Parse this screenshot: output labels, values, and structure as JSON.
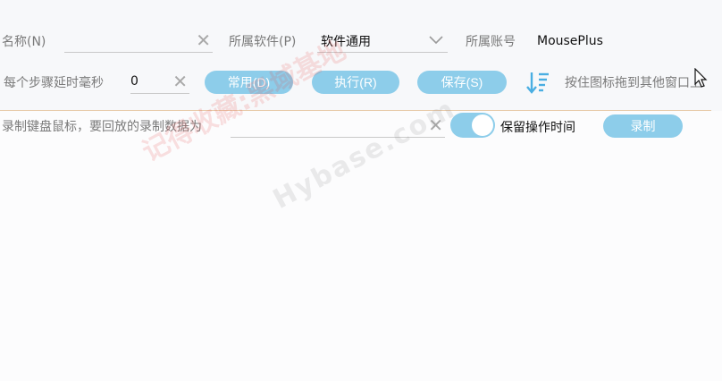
{
  "row1": {
    "name_label": "名称(N)",
    "name_value": "",
    "software_label": "所属软件(P)",
    "software_value": "软件通用",
    "account_label": "所属账号",
    "account_value": "MousePlus"
  },
  "row2": {
    "delay_label": "每个步骤延时毫秒",
    "delay_value": "0",
    "common_button": "常用(D)",
    "execute_button": "执行(R)",
    "save_button": "保存(S)",
    "drag_hint": "按住图标拖到其他窗口上"
  },
  "row3": {
    "record_label": "录制键盘鼠标，要回放的录制数据为",
    "record_value": "",
    "keep_time_label": "保留操作时间",
    "keep_time_on": true,
    "record_button": "录制"
  },
  "watermark": {
    "text_cn": "记得收藏:黑域基地",
    "text_en": "Hybase.com"
  },
  "colors": {
    "accent": "#8dcdea",
    "divider": "#e7c9a8"
  },
  "icons": {
    "clear": "close-icon",
    "dropdown": "chevron-down-icon",
    "sort": "sort-desc-icon",
    "cursor": "mouse-cursor-icon"
  }
}
